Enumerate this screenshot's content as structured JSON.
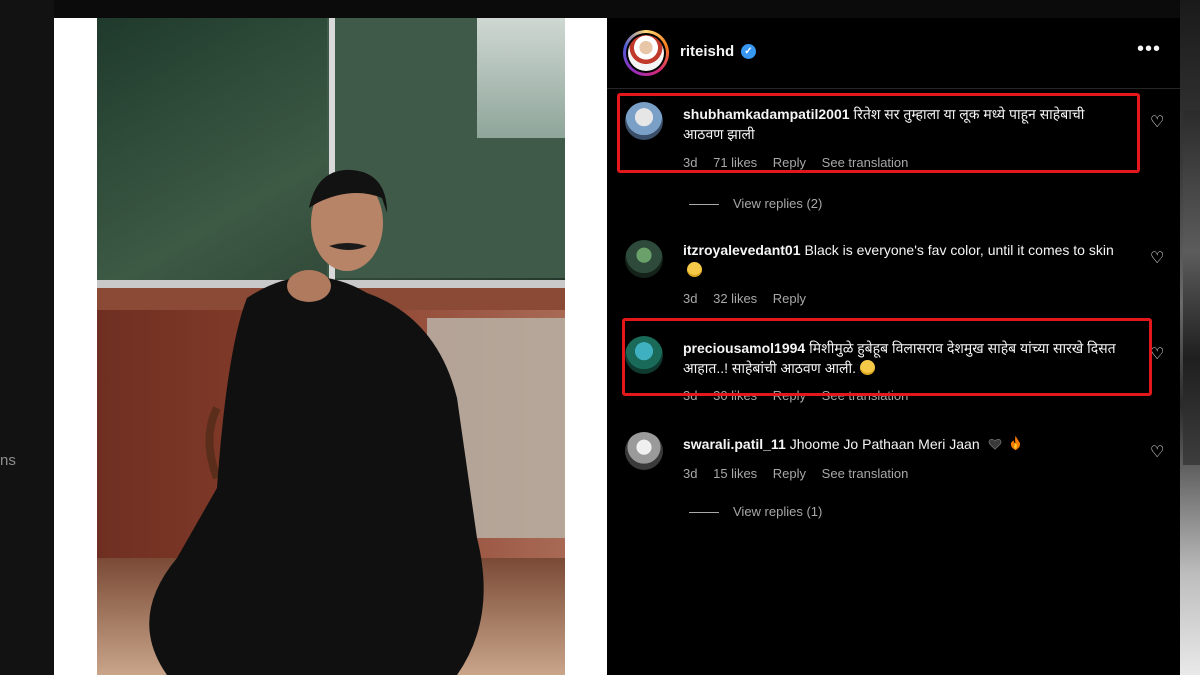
{
  "background": {
    "left_partial_text": "ns"
  },
  "post": {
    "username": "riteishd",
    "verified_icon": "verified-badge-icon",
    "more_icon": "more-options-icon",
    "more_label": "•••"
  },
  "comments": [
    {
      "username": "shubhamkadampatil2001",
      "text": "रितेश सर तुम्हाला या लूक मध्ये पाहून साहेबाची आठवण झाली",
      "age": "3d",
      "likes": "71 likes",
      "reply": "Reply",
      "translation": "See translation",
      "view_replies": "View replies (2)"
    },
    {
      "username": "itzroyalevedant01",
      "text": "Black is everyone's fav color, until it comes to skin",
      "emoji": "neutral-face-emoji",
      "age": "3d",
      "likes": "32 likes",
      "reply": "Reply"
    },
    {
      "username": "preciousamol1994",
      "text": "मिशीमुळे हुबेहूब विलासराव देशमुख साहेब यांच्या सारखे दिसत आहात..! साहेबांची आठवण आली.",
      "emoji": "smiling-face-emoji",
      "age": "3d",
      "likes": "30 likes",
      "reply": "Reply",
      "translation": "See translation"
    },
    {
      "username": "swarali.patil_11",
      "text": "Jhoome Jo Pathaan Meri Jaan",
      "emoji": "black-heart-emoji",
      "emoji2": "fire-emoji",
      "age": "3d",
      "likes": "15 likes",
      "reply": "Reply",
      "translation": "See translation",
      "view_replies": "View replies (1)"
    }
  ],
  "colors": {
    "highlight": "#e3181d",
    "verified": "#3897f0",
    "meta_text": "#a8a8a8"
  }
}
